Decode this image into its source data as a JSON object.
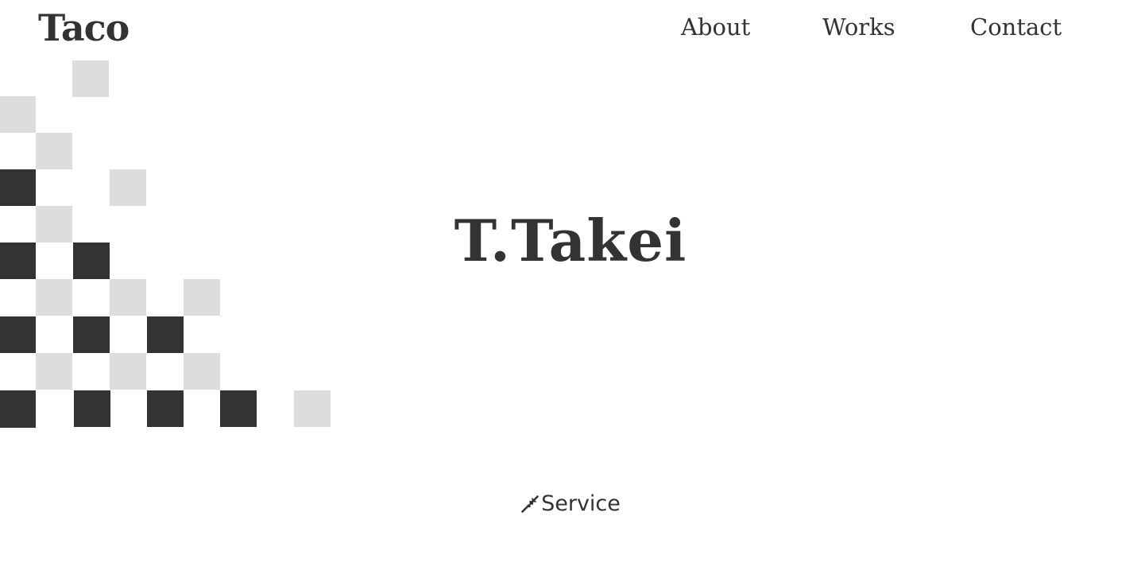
{
  "header": {
    "logo_text": "Taco",
    "nav": [
      {
        "label": "About"
      },
      {
        "label": "Works"
      },
      {
        "label": "Contact"
      }
    ]
  },
  "hero": {
    "title": "T.Takei"
  },
  "service_link": {
    "label": "Service",
    "icon": "collapse-arrow-icon"
  },
  "colors": {
    "text": "#333333",
    "tile_dark": "#333333",
    "tile_light": "#dddddd",
    "background": "#ffffff"
  }
}
